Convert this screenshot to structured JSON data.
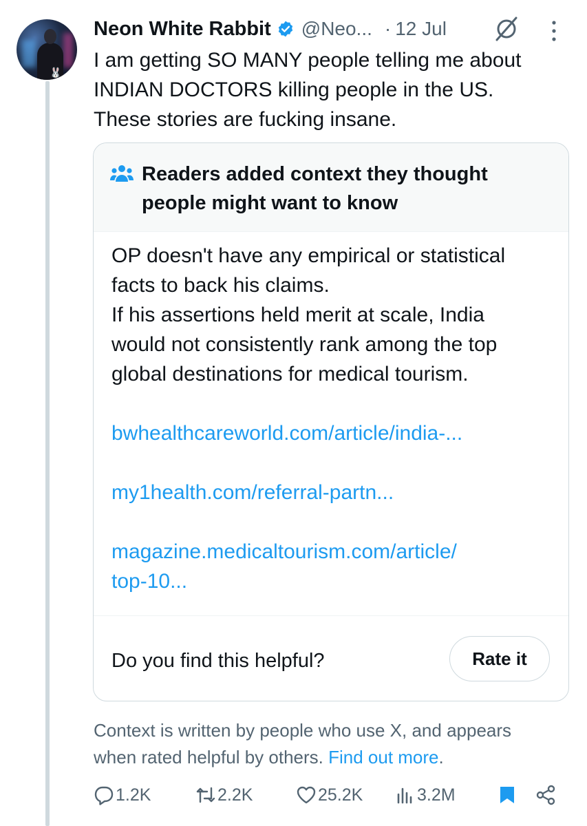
{
  "tweet": {
    "author_name": "Neon White Rabbit",
    "handle": "@Neo...",
    "separator": "·",
    "date": "12 Jul",
    "text_lines": [
      "I am getting SO MANY people telling me about",
      "INDIAN DOCTORS killing people in the US.",
      "These stories are fucking insane."
    ]
  },
  "community_note": {
    "title_lines": [
      "Readers added context they thought",
      "people might want to know"
    ],
    "body_lines": [
      "OP doesn't have any empirical or statistical",
      "facts to back his claims.",
      "If his assertions held merit at scale, India",
      "would not consistently rank among the top",
      "global destinations for medical tourism."
    ],
    "links": [
      "bwhealthcareworld.com/article/india-...",
      "my1health.com/referral-partn...",
      "magazine.medicaltourism.com/article/",
      "top-10..."
    ],
    "helpful_question": "Do you find this helpful?",
    "rate_button": "Rate it"
  },
  "context_info": {
    "line1": "Context is written by people who use X, and appears",
    "line2": "when rated helpful by others.",
    "find_out_more": "Find out more",
    "period": "."
  },
  "actions": {
    "replies": "1.2K",
    "reposts": "2.2K",
    "likes": "25.2K",
    "views": "3.2M"
  },
  "colors": {
    "accent": "#1d9bf0",
    "secondary_text": "#536471",
    "border": "#cfd9de",
    "note_header_bg": "#f7f9f9"
  },
  "icons": [
    "verified-badge-icon",
    "grok-icon",
    "more-icon",
    "people-icon",
    "reply-icon",
    "repost-icon",
    "like-icon",
    "views-icon",
    "bookmark-icon",
    "share-icon"
  ]
}
